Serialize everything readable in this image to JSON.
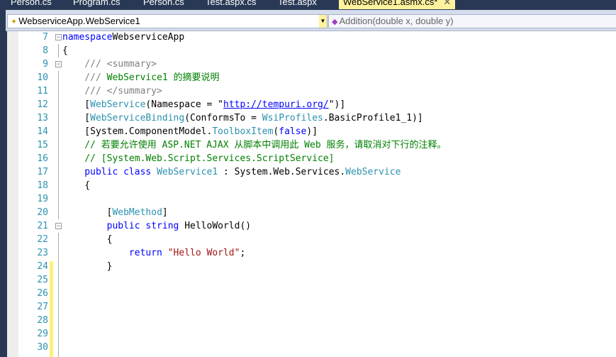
{
  "tabs": [
    {
      "label": "Person.cs"
    },
    {
      "label": "Program.cs"
    },
    {
      "label": "Person.cs"
    },
    {
      "label": "Test.aspx.cs"
    },
    {
      "label": "Test.aspx"
    },
    {
      "label": "WebService1.asmx.cs*",
      "active": true
    }
  ],
  "nav": {
    "type_selector": "WebserviceApp.WebService1",
    "member_selector": "Addition(double x, double y)"
  },
  "lines": [
    {
      "n": "7",
      "parts": [
        [
          "kw",
          "namespace"
        ],
        [
          "",
          "WebserviceApp"
        ]
      ]
    },
    {
      "n": "8",
      "parts": [
        [
          "",
          "{"
        ]
      ]
    },
    {
      "n": "9",
      "parts": [
        [
          "doc",
          "    /// <summary>"
        ]
      ]
    },
    {
      "n": "10",
      "parts": [
        [
          "doc",
          "    /// "
        ],
        [
          "cm",
          "WebService1 的摘要说明"
        ]
      ]
    },
    {
      "n": "11",
      "parts": [
        [
          "doc",
          "    /// </summary>"
        ]
      ]
    },
    {
      "n": "12",
      "parts": [
        [
          "",
          "    ["
        ],
        [
          "ty",
          "WebService"
        ],
        [
          "",
          "(Namespace = \""
        ],
        [
          "url",
          "http://tempuri.org/"
        ],
        [
          "",
          "\")]"
        ]
      ]
    },
    {
      "n": "13",
      "parts": [
        [
          "",
          "    ["
        ],
        [
          "ty",
          "WebServiceBinding"
        ],
        [
          "",
          "(ConformsTo = "
        ],
        [
          "ty",
          "WsiProfiles"
        ],
        [
          "",
          ".BasicProfile1_1)]"
        ]
      ]
    },
    {
      "n": "14",
      "parts": [
        [
          "",
          "    [System.ComponentModel."
        ],
        [
          "ty",
          "ToolboxItem"
        ],
        [
          "",
          "("
        ],
        [
          "kw",
          "false"
        ],
        [
          "",
          ")]"
        ]
      ]
    },
    {
      "n": "15",
      "parts": [
        [
          "cm",
          "    // 若要允许使用 ASP.NET AJAX 从脚本中调用此 Web 服务，请取消对下行的注释。"
        ]
      ]
    },
    {
      "n": "16",
      "parts": [
        [
          "cm",
          "    // [System.Web.Script.Services.ScriptService]"
        ]
      ]
    },
    {
      "n": "17",
      "parts": [
        [
          "kw",
          "    public class "
        ],
        [
          "ty",
          "WebService1"
        ],
        [
          "",
          " : System.Web.Services."
        ],
        [
          "ty",
          "WebService"
        ]
      ]
    },
    {
      "n": "18",
      "parts": [
        [
          "",
          "    {"
        ]
      ]
    },
    {
      "n": "19",
      "parts": []
    },
    {
      "n": "20",
      "parts": [
        [
          "",
          "        ["
        ],
        [
          "ty",
          "WebMethod"
        ],
        [
          "",
          "]"
        ]
      ]
    },
    {
      "n": "21",
      "parts": [
        [
          "kw",
          "        public string "
        ],
        [
          "",
          "HelloWorld()"
        ]
      ]
    },
    {
      "n": "22",
      "parts": [
        [
          "",
          "        {"
        ]
      ]
    },
    {
      "n": "23",
      "parts": [
        [
          "kw",
          "            return "
        ],
        [
          "str",
          "\"Hello World\""
        ],
        [
          "",
          ";"
        ]
      ]
    },
    {
      "n": "24",
      "parts": [
        [
          "",
          "        }"
        ]
      ]
    },
    {
      "n": "25",
      "parts": []
    },
    {
      "n": "26",
      "parts": []
    },
    {
      "n": "27",
      "parts": []
    },
    {
      "n": "28",
      "parts": []
    },
    {
      "n": "29",
      "parts": []
    },
    {
      "n": "30",
      "parts": []
    }
  ]
}
